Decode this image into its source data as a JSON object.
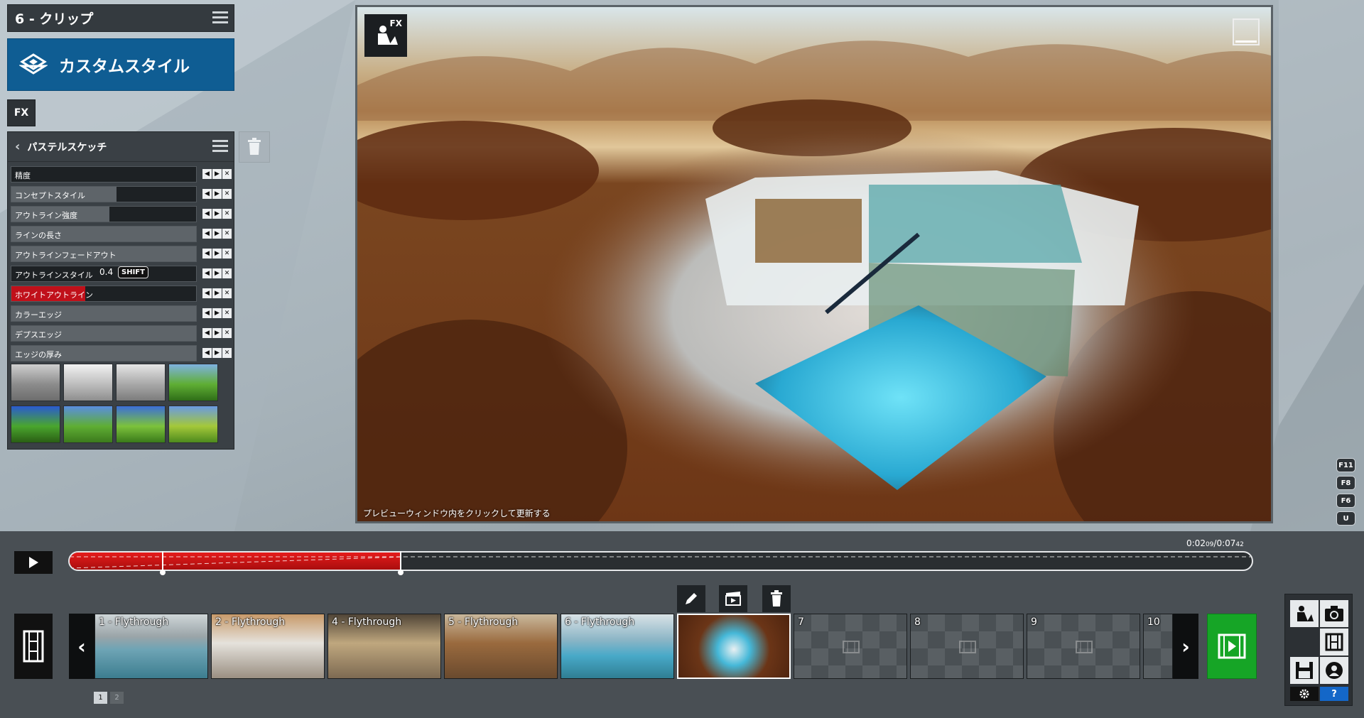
{
  "clip_header": {
    "title": "6 - クリップ"
  },
  "style_banner": {
    "label": "カスタムスタイル"
  },
  "fx_tab": {
    "label": "FX"
  },
  "effect": {
    "name": "パステルスケッチ",
    "params": [
      {
        "label": "精度",
        "level": 0.0,
        "active": false
      },
      {
        "label": "コンセプトスタイル",
        "level": 0.57,
        "active": false
      },
      {
        "label": "アウトライン強度",
        "level": 0.53,
        "active": false
      },
      {
        "label": "ラインの長さ",
        "level": 1.0,
        "active": false
      },
      {
        "label": "アウトラインフェードアウト",
        "level": 1.0,
        "active": false
      },
      {
        "label": "アウトラインスタイル",
        "level": 0.0,
        "active": false,
        "value": "0.4",
        "hint": "SHIFT"
      },
      {
        "label": "ホワイトアウトライン",
        "level": 0.4,
        "active": true
      },
      {
        "label": "カラーエッジ",
        "level": 1.0,
        "active": false
      },
      {
        "label": "デプスエッジ",
        "level": 1.0,
        "active": false
      },
      {
        "label": "エッジの厚み",
        "level": 1.0,
        "active": false
      }
    ]
  },
  "preview": {
    "note": "プレビューウィンドウ内をクリックして更新する",
    "fx_badge": "FX"
  },
  "hotkeys": [
    "F11",
    "F8",
    "F6",
    "U"
  ],
  "timeline": {
    "time_current": "0:02",
    "time_current_frames": "09",
    "time_total": "0:07",
    "time_total_frames": "42",
    "progress": 0.28
  },
  "clips": [
    {
      "label": "1 - Flythrough"
    },
    {
      "label": "2 - Flythrough"
    },
    {
      "label": "4 - Flythrough"
    },
    {
      "label": "5 - Flythrough"
    },
    {
      "label": "6 - Flythrough"
    },
    {
      "label": ""
    },
    {
      "label": "7"
    },
    {
      "label": "8"
    },
    {
      "label": "9"
    },
    {
      "label": "10"
    }
  ],
  "pagination": [
    "1",
    "2"
  ],
  "colors": {
    "accent_blue": "#0f5d93",
    "active_red": "#c0101a",
    "green": "#16a526"
  }
}
